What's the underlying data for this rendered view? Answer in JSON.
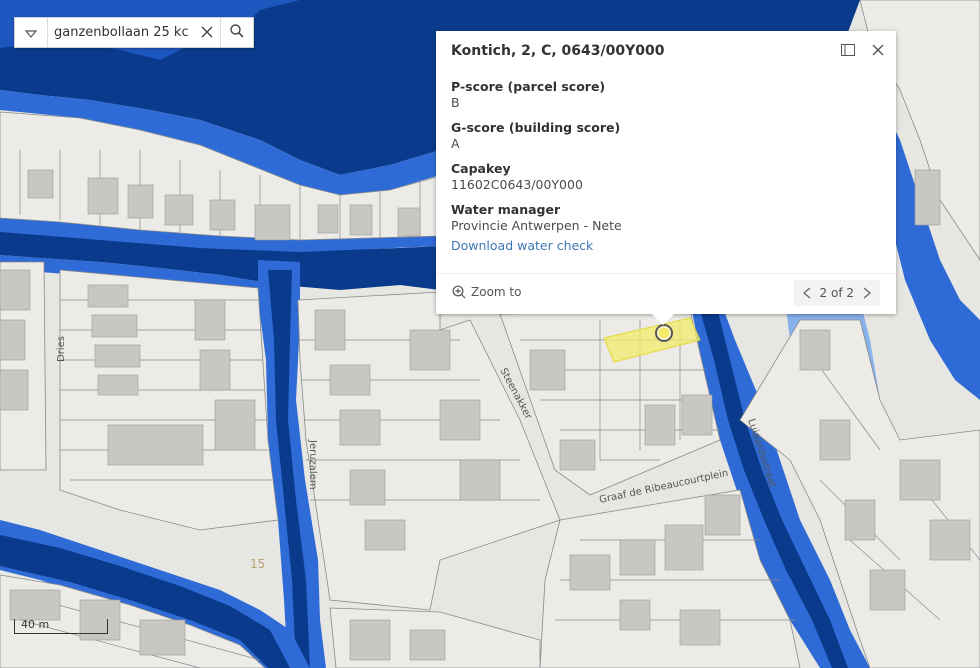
{
  "search": {
    "value": "ganzenbollaan 25 kc",
    "dropdown_icon": "triangle-down-icon",
    "clear_icon": "close-icon",
    "search_icon": "search-icon"
  },
  "popup": {
    "title": "Kontich, 2, C, 0643/00Y000",
    "fields": [
      {
        "label": "P-score (parcel score)",
        "value": "B"
      },
      {
        "label": "G-score (building score)",
        "value": "A"
      },
      {
        "label": "Capakey",
        "value": "11602C0643/00Y000"
      },
      {
        "label": "Water manager",
        "value": "Provincie Antwerpen - Nete"
      }
    ],
    "link": "Download water check",
    "zoom_label": "Zoom to",
    "pager": "2 of 2"
  },
  "map": {
    "streets": [
      "Dries",
      "Steenakker",
      "Graaf de Ribeaucourtplein",
      "Jeruzalem",
      "Luiaardsstraat"
    ],
    "parcel_number": "15",
    "colors": {
      "flood_dark": "#0a3a8c",
      "flood_mid": "#2f6bd6",
      "flood_light": "#88b2ec",
      "land": "#e6e6e2",
      "building": "#c9c7c2",
      "highlight": "#f3ec6b"
    }
  },
  "scale": {
    "label": "40 m"
  }
}
